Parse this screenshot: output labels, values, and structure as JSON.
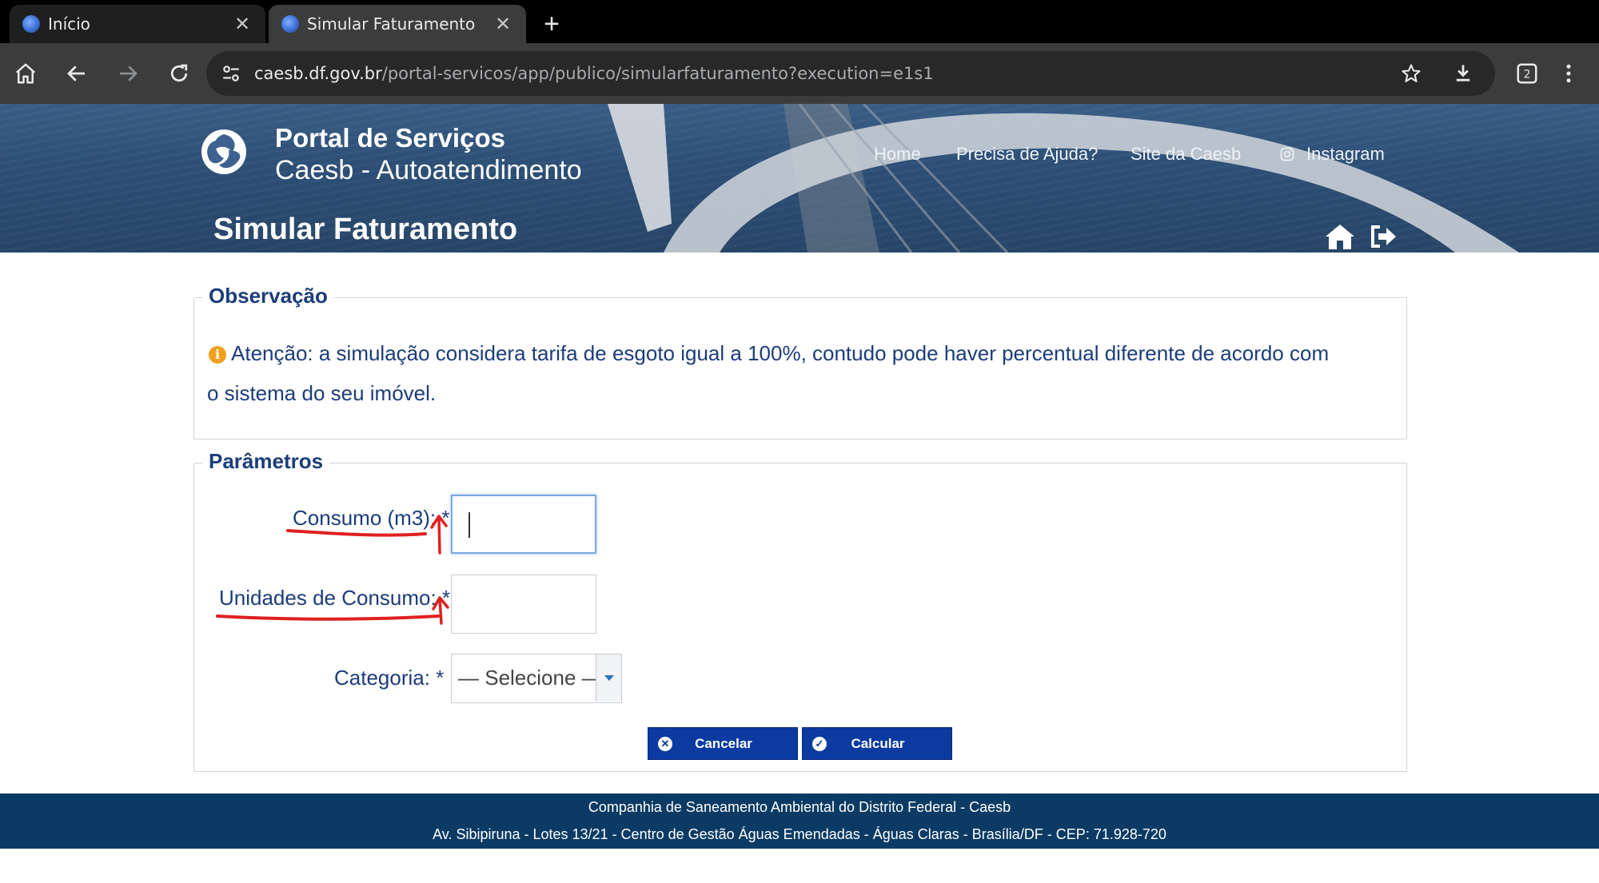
{
  "browser": {
    "tabs": [
      {
        "title": "Início",
        "active": false
      },
      {
        "title": "Simular Faturamento",
        "active": true
      }
    ],
    "url_host": "caesb.df.gov.br",
    "url_path": "/portal-servicos/app/publico/simularfaturamento?execution=e1s1",
    "tab_count": "2",
    "icons": [
      "home-icon",
      "back-icon",
      "forward-icon",
      "reload-icon",
      "site-info-icon",
      "bookmark-star-icon",
      "download-icon",
      "tab-switcher-icon",
      "menu-icon"
    ]
  },
  "header": {
    "brand_title": "Portal de Serviços",
    "brand_subtitle": "Caesb - Autoatendimento",
    "nav": [
      "Home",
      "Precisa de Ajuda?",
      "Site da Caesb",
      "Instagram"
    ],
    "page_title": "Simular Faturamento"
  },
  "observacao": {
    "legend": "Observação",
    "text": "Atenção: a simulação considera tarifa de esgoto igual a 100%, contudo pode haver percentual diferente de acordo com o sistema do seu imóvel."
  },
  "parametros": {
    "legend": "Parâmetros",
    "consumo_label": "Consumo (m3):",
    "unidades_label": "Unidades de Consumo:",
    "categoria_label": "Categoria:",
    "required_mark": "*",
    "consumo_value": "",
    "unidades_value": "",
    "categoria_selected": "— Selecione —",
    "cancel_label": "Cancelar",
    "calculate_label": "Calcular"
  },
  "footer": {
    "line1": "Companhia de Saneamento Ambiental do Distrito Federal - Caesb",
    "line2": "Av. Sibipiruna - Lotes 13/21 - Centro de Gestão Águas Emendadas - Águas Claras - Brasília/DF - CEP: 71.928-720"
  },
  "colors": {
    "primary_button": "#0b3aa0",
    "label_text": "#1c3c7b",
    "footer_bg": "#0b3b64",
    "annotation": "#e02020"
  }
}
